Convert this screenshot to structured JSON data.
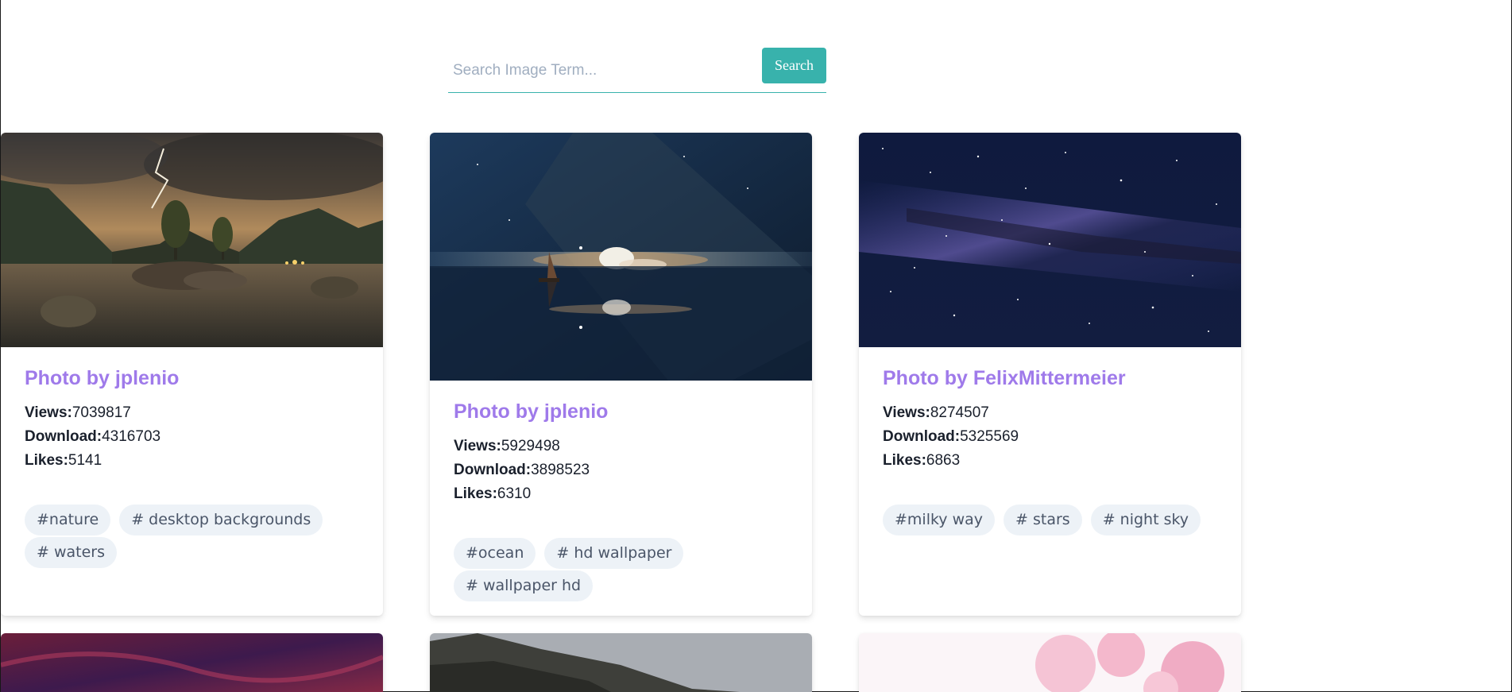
{
  "search": {
    "placeholder": "Search Image Term...",
    "button_label": "Search"
  },
  "cards": [
    {
      "title": "Photo by jplenio",
      "views_label": "Views:",
      "views": "7039817",
      "downloads_label": "Download:",
      "downloads": "4316703",
      "likes_label": "Likes:",
      "likes": "5141",
      "tags": [
        "#nature",
        "# desktop backgrounds",
        "# waters"
      ],
      "image_theme": "lake-mountains-lightning"
    },
    {
      "title": "Photo by jplenio",
      "views_label": "Views:",
      "views": "5929498",
      "downloads_label": "Download:",
      "downloads": "3898523",
      "likes_label": "Likes:",
      "likes": "6310",
      "tags": [
        "#ocean",
        "# hd wallpaper",
        "# wallpaper hd"
      ],
      "image_theme": "ocean-milky-way-sailboat"
    },
    {
      "title": "Photo by FelixMittermeier",
      "views_label": "Views:",
      "views": "8274507",
      "downloads_label": "Download:",
      "downloads": "5325569",
      "likes_label": "Likes:",
      "likes": "6863",
      "tags": [
        "#milky way",
        "# stars",
        "# night sky"
      ],
      "image_theme": "milky-way-stars"
    }
  ],
  "colors": {
    "accent": "#38b2ac",
    "title": "#9f7aea",
    "tag_bg": "#edf2f7",
    "tag_text": "#4a5568"
  }
}
